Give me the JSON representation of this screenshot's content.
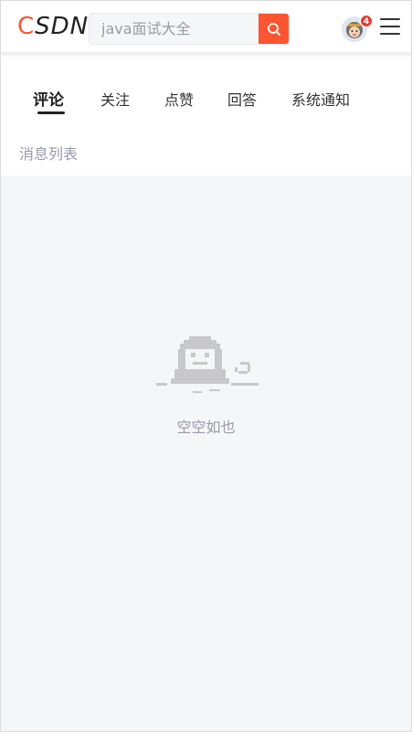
{
  "header": {
    "logo_c": "C",
    "logo_rest": "SDN",
    "search": {
      "placeholder": "java面试大全"
    },
    "notification_count": "4"
  },
  "tabs": [
    {
      "label": "评论",
      "active": true
    },
    {
      "label": "关注",
      "active": false
    },
    {
      "label": "点赞",
      "active": false
    },
    {
      "label": "回答",
      "active": false
    },
    {
      "label": "系统通知",
      "active": false
    }
  ],
  "section_title": "消息列表",
  "empty_state": {
    "text": "空空如也"
  },
  "colors": {
    "accent": "#fc5531",
    "badge": "#e33e33",
    "muted_text": "#999aaa",
    "background": "#f5f6f7"
  }
}
